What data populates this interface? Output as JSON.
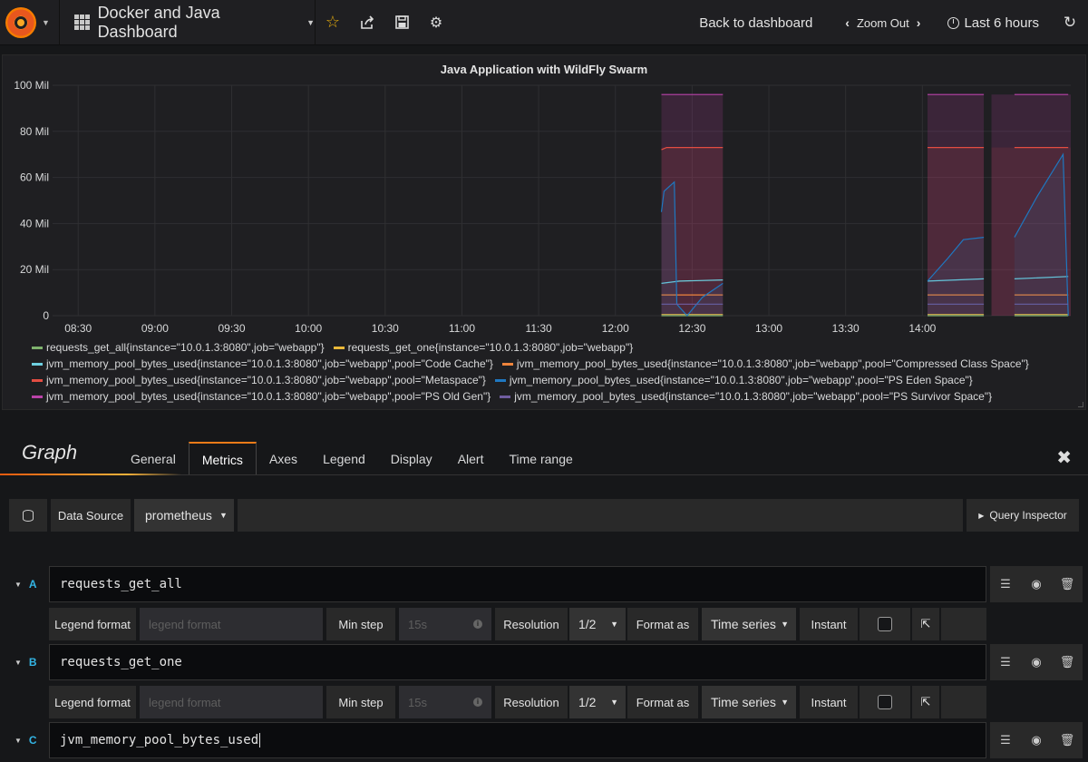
{
  "navbar": {
    "dashboard_title": "Docker and Java Dashboard",
    "back_label": "Back to dashboard",
    "zoom_label": "Zoom Out",
    "time_range": "Last 6 hours"
  },
  "panel": {
    "title": "Java Application with WildFly Swarm"
  },
  "chart_data": {
    "type": "area",
    "title": "Java Application with WildFly Swarm",
    "ylim": [
      0,
      100
    ],
    "yticks": [
      "0",
      "20 Mil",
      "40 Mil",
      "60 Mil",
      "80 Mil",
      "100 Mil"
    ],
    "xticks": [
      "08:30",
      "09:00",
      "09:30",
      "10:00",
      "10:30",
      "11:00",
      "11:30",
      "12:00",
      "12:30",
      "13:00",
      "13:30",
      "14:00"
    ],
    "x_range_minutes": [
      500,
      898
    ],
    "grid": true,
    "legend_placement": "bottom",
    "series": [
      {
        "name": "requests_get_all{instance=\"10.0.1.3:8080\",job=\"webapp\"}",
        "color": "#7eb26d",
        "points": [
          [
            738,
            0
          ],
          [
            762,
            0
          ],
          [
            842,
            0
          ],
          [
            864,
            0
          ],
          [
            876,
            0
          ],
          [
            897,
            0
          ]
        ]
      },
      {
        "name": "requests_get_one{instance=\"10.0.1.3:8080\",job=\"webapp\"}",
        "color": "#eab839",
        "points": [
          [
            738,
            0.5
          ],
          [
            762,
            0.5
          ],
          [
            842,
            0.5
          ],
          [
            864,
            0.5
          ],
          [
            876,
            0.5
          ],
          [
            897,
            0.5
          ]
        ]
      },
      {
        "name": "jvm_memory_pool_bytes_used{instance=\"10.0.1.3:8080\",job=\"webapp\",pool=\"Code Cache\"}",
        "color": "#6ed0e0",
        "points": [
          [
            738,
            14
          ],
          [
            745,
            15
          ],
          [
            762,
            15.5
          ],
          [
            842,
            15
          ],
          [
            864,
            16
          ],
          [
            876,
            16
          ],
          [
            897,
            17
          ]
        ]
      },
      {
        "name": "jvm_memory_pool_bytes_used{instance=\"10.0.1.3:8080\",job=\"webapp\",pool=\"Compressed Class Space\"}",
        "color": "#ef843c",
        "points": [
          [
            738,
            9
          ],
          [
            762,
            9
          ],
          [
            842,
            9
          ],
          [
            864,
            9
          ],
          [
            876,
            9
          ],
          [
            897,
            9
          ]
        ]
      },
      {
        "name": "jvm_memory_pool_bytes_used{instance=\"10.0.1.3:8080\",job=\"webapp\",pool=\"Metaspace\"}",
        "color": "#e24d42",
        "points": [
          [
            738,
            72
          ],
          [
            740,
            73
          ],
          [
            762,
            73
          ],
          [
            842,
            73
          ],
          [
            864,
            73
          ],
          [
            876,
            73
          ],
          [
            897,
            73
          ]
        ]
      },
      {
        "name": "jvm_memory_pool_bytes_used{instance=\"10.0.1.3:8080\",job=\"webapp\",pool=\"PS Eden Space\"}",
        "color": "#1f78c1",
        "points": [
          [
            738,
            45
          ],
          [
            739,
            54
          ],
          [
            743,
            58
          ],
          [
            744,
            5
          ],
          [
            748,
            0
          ],
          [
            754,
            8
          ],
          [
            762,
            14
          ],
          [
            842,
            15
          ],
          [
            850,
            25
          ],
          [
            856,
            33
          ],
          [
            864,
            34
          ],
          [
            876,
            34
          ],
          [
            885,
            52
          ],
          [
            895,
            70
          ],
          [
            897,
            0
          ]
        ]
      },
      {
        "name": "jvm_memory_pool_bytes_used{instance=\"10.0.1.3:8080\",job=\"webapp\",pool=\"PS Old Gen\"}",
        "color": "#ba43a9",
        "points": [
          [
            738,
            96
          ],
          [
            762,
            96
          ],
          [
            842,
            96
          ],
          [
            864,
            96
          ],
          [
            876,
            96
          ],
          [
            897,
            96
          ]
        ]
      },
      {
        "name": "jvm_memory_pool_bytes_used{instance=\"10.0.1.3:8080\",job=\"webapp\",pool=\"PS Survivor Space\"}",
        "color": "#705da0",
        "points": [
          [
            738,
            5
          ],
          [
            762,
            5
          ],
          [
            842,
            5
          ],
          [
            864,
            5
          ],
          [
            876,
            5
          ],
          [
            897,
            5
          ]
        ]
      }
    ],
    "segments": [
      [
        738,
        762
      ],
      [
        842,
        864
      ],
      [
        867,
        898
      ]
    ]
  },
  "editor": {
    "title": "Graph",
    "tabs": [
      "General",
      "Metrics",
      "Axes",
      "Legend",
      "Display",
      "Alert",
      "Time range"
    ],
    "active_tab": "Metrics",
    "close_glyph": "✖"
  },
  "datasource": {
    "label": "Data Source",
    "value": "prometheus",
    "query_inspector": "Query Inspector"
  },
  "queries": [
    {
      "letter": "A",
      "expr": "requests_get_all",
      "legend_label": "Legend format",
      "legend_placeholder": "legend format",
      "minstep_label": "Min step",
      "minstep_placeholder": "15s",
      "resolution_label": "Resolution",
      "resolution": "1/2",
      "format_label": "Format as",
      "format": "Time series",
      "instant_label": "Instant"
    },
    {
      "letter": "B",
      "expr": "requests_get_one",
      "legend_label": "Legend format",
      "legend_placeholder": "legend format",
      "minstep_label": "Min step",
      "minstep_placeholder": "15s",
      "resolution_label": "Resolution",
      "resolution": "1/2",
      "format_label": "Format as",
      "format": "Time series",
      "instant_label": "Instant"
    },
    {
      "letter": "C",
      "expr": "jvm_memory_pool_bytes_used"
    }
  ]
}
